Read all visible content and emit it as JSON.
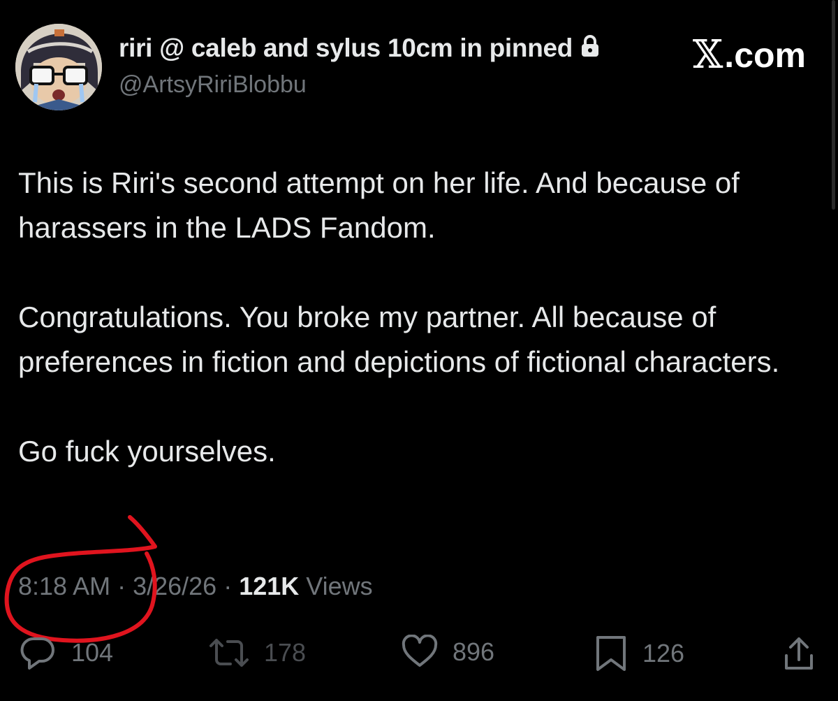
{
  "header": {
    "display_name": "riri @ caleb and sylus 10cm in pinned",
    "handle": "@ArtsyRiriBlobbu",
    "brand": ".com",
    "avatar_icon": "avatar-chibi-icon",
    "lock_icon": "lock-icon"
  },
  "tweet": {
    "paragraphs": [
      "This is Riri's second attempt on her life. And because of harassers in the LADS Fandom.",
      "Congratulations. You broke my partner. All because of preferences in fiction and depictions of fictional characters.",
      "Go fuck yourselves."
    ]
  },
  "meta": {
    "time": "8:18 AM",
    "sep1": " · ",
    "date": "3/26/26",
    "sep2": " · ",
    "view_count": "121K",
    "views_label": " Views"
  },
  "actions": {
    "replies": "104",
    "reposts": "178",
    "likes": "896",
    "bookmarks": "126"
  },
  "colors": {
    "background": "#000000",
    "primary_text": "#e7e9ea",
    "secondary_text": "#71767b",
    "annotation_red": "#e0141e"
  }
}
